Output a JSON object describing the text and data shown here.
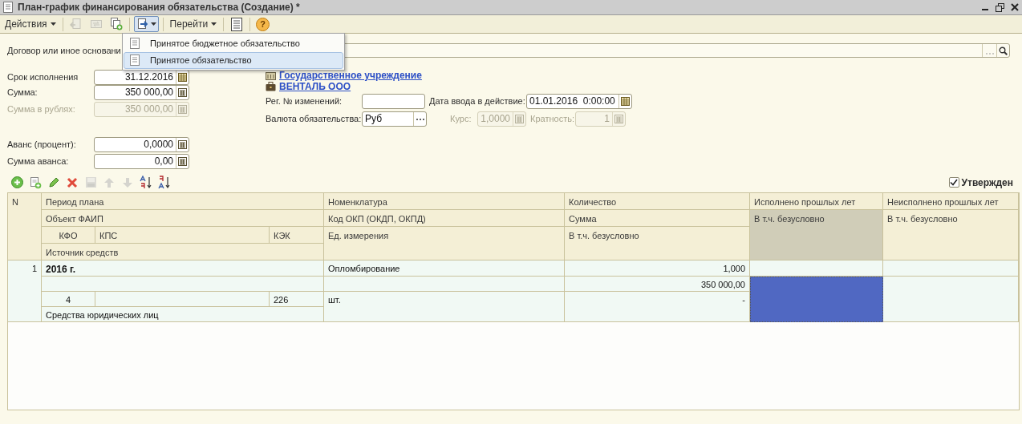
{
  "window": {
    "title": "План-график финансирования обязательства (Создание) *"
  },
  "toolbar": [
    {
      "kind": "menu",
      "label": "Действия",
      "disabled": false
    },
    {
      "kind": "separator"
    },
    {
      "kind": "post",
      "disabled": true
    },
    {
      "kind": "refresh",
      "disabled": true
    },
    {
      "kind": "copy",
      "disabled": false
    },
    {
      "kind": "separator"
    },
    {
      "kind": "create-from",
      "disabled": false,
      "expanded": true
    },
    {
      "kind": "separator"
    },
    {
      "kind": "menu",
      "label": "Перейти",
      "disabled": false
    },
    {
      "kind": "separator"
    },
    {
      "kind": "report",
      "disabled": false
    },
    {
      "kind": "separator"
    },
    {
      "kind": "help",
      "label": "?",
      "disabled": false
    }
  ],
  "dropdown": [
    {
      "label": "Принятое бюджетное обязательство",
      "selected": false
    },
    {
      "label": "Принятое обязательство",
      "selected": true
    }
  ],
  "form": {
    "basis": {
      "label": "Договор или иное основани"
    },
    "due_date": {
      "label": "Срок исполнения",
      "value": "31.12.2016",
      "disabled": false
    },
    "amount": {
      "label": "Сумма:",
      "value": "350 000,00",
      "disabled": false
    },
    "amount_rub": {
      "label": "Сумма в рублях:",
      "value": "350 000,00",
      "disabled": true
    },
    "advance_percent": {
      "label": "Аванс (процент):",
      "value": "0,0000",
      "disabled": false
    },
    "advance_sum": {
      "label": "Сумма аванса:",
      "value": "0,00",
      "disabled": false
    },
    "institution_link": "Государственное учреждение",
    "counterparty_link": "ВЕНТАЛЬ ООО",
    "reg_no": {
      "label": "Рег. № изменений:",
      "disabled": false
    },
    "effective_date": {
      "label": "Дата ввода в действие:",
      "value": "01.01.2016  0:00:00",
      "disabled": false
    },
    "currency": {
      "label": "Валюта обязательства:",
      "value": "Руб",
      "disabled": false
    },
    "rate": {
      "label": "Курс:",
      "value": "1,0000",
      "disabled": true
    },
    "multiplicity": {
      "label": "Кратность:",
      "value": "1",
      "disabled": true
    }
  },
  "table_toolbar": [
    {
      "kind": "add",
      "disabled": false
    },
    {
      "kind": "copy-add",
      "disabled": false
    },
    {
      "kind": "edit",
      "disabled": false
    },
    {
      "kind": "delete",
      "disabled": false
    },
    {
      "kind": "save",
      "disabled": true
    },
    {
      "kind": "up",
      "disabled": true
    },
    {
      "kind": "down",
      "disabled": true
    },
    {
      "kind": "sort-asc",
      "disabled": false
    },
    {
      "kind": "sort-desc",
      "disabled": false
    }
  ],
  "approved": {
    "label": "Утвержден",
    "checked": true
  },
  "table": {
    "header": [
      {
        "label": "N",
        "selected": false
      },
      {
        "label": "Период плана",
        "selected": false
      },
      {
        "label": "Объект ФАИП",
        "selected": false
      },
      {
        "label": "КФО",
        "selected": false
      },
      {
        "label": "КПС",
        "selected": false
      },
      {
        "label": "КЭК",
        "selected": false
      },
      {
        "label": "Источник средств",
        "selected": false
      },
      {
        "label": "Номенклатура",
        "selected": false
      },
      {
        "label": "Код ОКП (ОКДП,  ОКПД)",
        "selected": false
      },
      {
        "label": "Ед. измерения",
        "selected": false
      },
      {
        "label": "Количество",
        "selected": false
      },
      {
        "label": "Сумма",
        "selected": false
      },
      {
        "label": "В т.ч. безусловно",
        "selected": false
      },
      {
        "label": "Исполнено прошлых лет",
        "selected": false
      },
      {
        "label": "В т.ч. безусловно",
        "selected": true
      },
      {
        "label": "Неисполнено прошлых лет",
        "selected": false
      },
      {
        "label": "В т.ч. безусловно",
        "selected": false
      }
    ],
    "rows": [
      {
        "cells": [
          {
            "text": "1",
            "selected": false
          },
          {
            "text": "2016 г.",
            "selected": false
          },
          {
            "selected": false
          },
          {
            "text": "4",
            "selected": false
          },
          {
            "selected": false
          },
          {
            "text": "226",
            "selected": false
          },
          {
            "text": "Средства юридических лиц",
            "selected": false
          },
          {
            "text": "Опломбирование",
            "selected": false
          },
          {
            "selected": false
          },
          {
            "text": "шт.",
            "selected": false
          },
          {
            "text": "1,000",
            "selected": false
          },
          {
            "text": "350 000,00",
            "selected": false
          },
          {
            "text": "-",
            "selected": false
          },
          {
            "selected": false
          },
          {
            "selected": true
          },
          {
            "selected": false
          },
          {
            "selected": false
          }
        ]
      }
    ]
  }
}
